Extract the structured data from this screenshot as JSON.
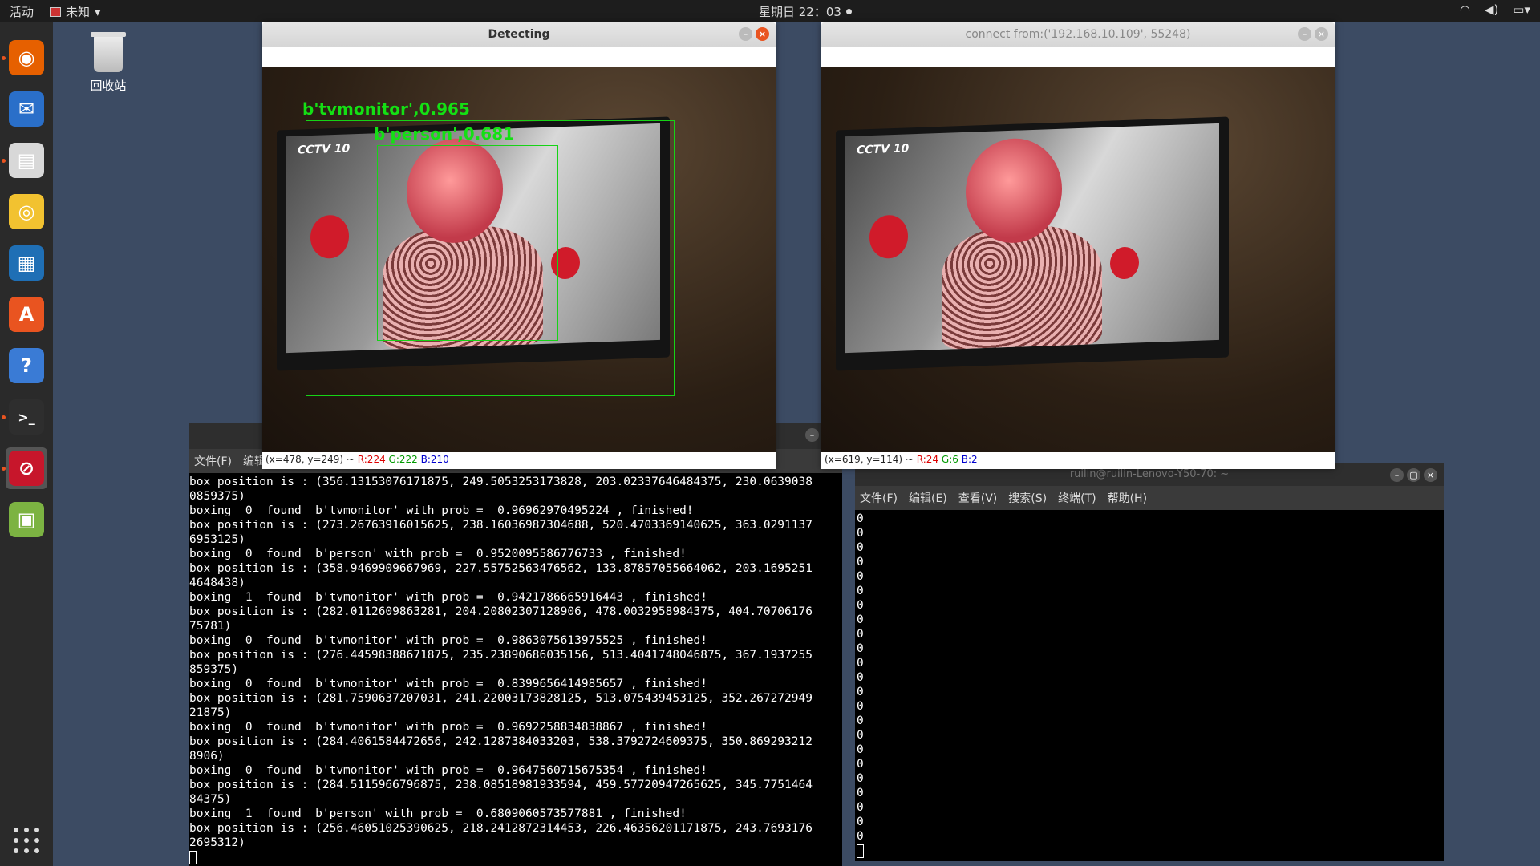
{
  "topbar": {
    "activities": "活动",
    "app_name": "未知",
    "clock": "星期日 22：03"
  },
  "desktop": {
    "trash_label": "回收站"
  },
  "dock": {
    "items": [
      {
        "name": "firefox-icon",
        "color": "#e66000"
      },
      {
        "name": "thunderbird-icon",
        "color": "#2a6fc9"
      },
      {
        "name": "files-icon",
        "color": "#d8d8d8"
      },
      {
        "name": "rhythmbox-icon",
        "color": "#f2c230"
      },
      {
        "name": "libreoffice-writer-icon",
        "color": "#1f6fb5"
      },
      {
        "name": "software-center-icon",
        "color": "#e95420"
      },
      {
        "name": "help-icon",
        "color": "#3a7bd5"
      },
      {
        "name": "terminal-icon",
        "color": "#2e2e2e"
      },
      {
        "name": "blocked-app-icon",
        "color": "#c7162b"
      },
      {
        "name": "image-viewer-icon",
        "color": "#7cb342"
      }
    ]
  },
  "detecting_window": {
    "title": "Detecting",
    "status_prefix": "(x=478, y=249) ~ ",
    "r": "R:224",
    "g": "G:222",
    "b": "B:210",
    "detections": [
      {
        "label": "b'tvmonitor',0.965"
      },
      {
        "label": "b'person',0.681"
      }
    ]
  },
  "client_window": {
    "title": "connect from:('192.168.10.109', 55248)",
    "status_prefix": "(x=619, y=114) ~ ",
    "r": "R:24",
    "g": "G:6",
    "b": "B:2"
  },
  "scene": {
    "channel_logo": "CCTV 10"
  },
  "left_terminal": {
    "menu": [
      "文件(F)",
      "编辑"
    ],
    "lines": [
      "box position is : (356.13153076171875, 249.5053253173828, 203.02337646484375, 230.0639038",
      "0859375)",
      "boxing  0  found  b'tvmonitor' with prob =  0.96962970495224 , finished!",
      "box position is : (273.26763916015625, 238.16036987304688, 520.4703369140625, 363.0291137",
      "6953125)",
      "boxing  0  found  b'person' with prob =  0.9520095586776733 , finished!",
      "box position is : (358.9469909667969, 227.55752563476562, 133.87857055664062, 203.1695251",
      "4648438)",
      "boxing  1  found  b'tvmonitor' with prob =  0.9421786665916443 , finished!",
      "box position is : (282.0112609863281, 204.20802307128906, 478.0032958984375, 404.70706176",
      "75781)",
      "boxing  0  found  b'tvmonitor' with prob =  0.9863075613975525 , finished!",
      "box position is : (276.44598388671875, 235.23890686035156, 513.4041748046875, 367.1937255",
      "859375)",
      "boxing  0  found  b'tvmonitor' with prob =  0.8399656414985657 , finished!",
      "box position is : (281.7590637207031, 241.22003173828125, 513.075439453125, 352.267272949",
      "21875)",
      "boxing  0  found  b'tvmonitor' with prob =  0.9692258834838867 , finished!",
      "box position is : (284.4061584472656, 242.1287384033203, 538.3792724609375, 350.869293212",
      "8906)",
      "boxing  0  found  b'tvmonitor' with prob =  0.9647560715675354 , finished!",
      "box position is : (284.5115966796875, 238.08518981933594, 459.57720947265625, 345.7751464",
      "84375)",
      "boxing  1  found  b'person' with prob =  0.6809060573577881 , finished!",
      "box position is : (256.46051025390625, 218.2412872314453, 226.46356201171875, 243.7693176",
      "2695312)"
    ]
  },
  "right_terminal": {
    "title": "ruilin@ruilin-Lenovo-Y50-70: ~",
    "menu": [
      "文件(F)",
      "编辑(E)",
      "查看(V)",
      "搜索(S)",
      "终端(T)",
      "帮助(H)"
    ],
    "lines": [
      "0",
      "0",
      "0",
      "0",
      "0",
      "0",
      "0",
      "0",
      "0",
      "0",
      "0",
      "0",
      "0",
      "0",
      "0",
      "0",
      "0",
      "0",
      "0",
      "0",
      "0",
      "0",
      "0"
    ]
  }
}
